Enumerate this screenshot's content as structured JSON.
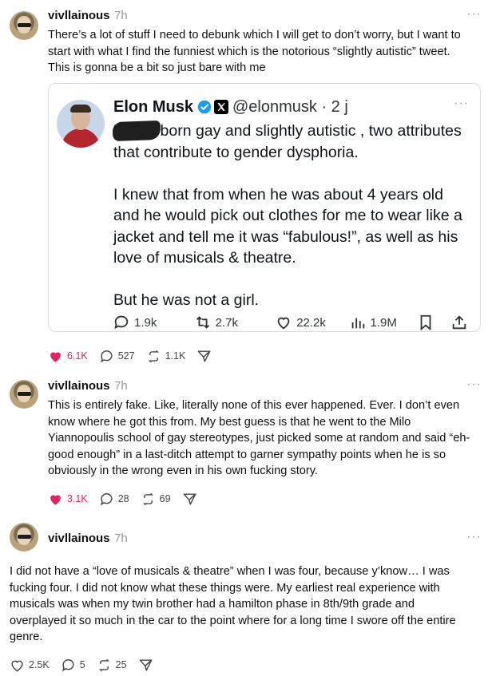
{
  "posts": [
    {
      "username": "vivllainous",
      "time": "7h",
      "more": "···",
      "text_lines": [
        "There’s a lot of stuff I need to debunk which I will get to don’t worry, but I want to",
        "start with what I find the funniest which is the notorious “slightly autistic” tweet.",
        "This is gonna be a bit so just bare with me"
      ],
      "likes": "6.1K",
      "replies": "527",
      "reposts": "1.1K",
      "liked": true
    },
    {
      "username": "vivllainous",
      "time": "7h",
      "more": "···",
      "text_lines": [
        "This is entirely fake. Like, literally none of this ever happened. Ever. I don’t even",
        "know where he got this from. My best guess is that he went to the Milo",
        "Yiannopoulis school of gay stereotypes, just picked some at random and said “eh-",
        "good enough” in a last-ditch attempt to garner sympathy points when he is so",
        "obviously in the wrong even in his own fucking story."
      ],
      "likes": "3.1K",
      "replies": "28",
      "reposts": "69",
      "liked": true
    },
    {
      "username": "vivllainous",
      "time": "7h",
      "more": "···",
      "text_lines": [
        "I did not have a “love of musicals & theatre” when I was four, because y’know… I was",
        "fucking four. I did not know what these things were. My earliest real experience with",
        "musicals was when my twin brother had a hamilton phase in 8th/9th grade and",
        "overplayed it so much in the car to the point where for a long time I swore off the entire",
        "genre."
      ],
      "likes": "2.5K",
      "replies": "5",
      "reposts": "25",
      "liked": false
    }
  ],
  "embed": {
    "name": "Elon Musk",
    "handle": "@elonmusk · 2 j",
    "more": "···",
    "paragraphs": [
      "X  was born gay and slightly autistic , two attributes that contribute to gender dysphoria.",
      "I knew that from when he was about 4 years old and he would pick out clothes for me to wear like a jacket and tell me it was “fabulous!”, as well as his love of musicals & theatre.",
      "But he was not a girl."
    ],
    "replies": "1.9k",
    "reposts": "2.7k",
    "likes": "22.2k",
    "views": "1.9M"
  },
  "colors": {
    "like_red": "#e0245e",
    "verified_blue": "#1d9bf0",
    "muted": "#999999"
  },
  "icons": [
    "heart-icon",
    "comment-icon",
    "repost-icon",
    "share-icon",
    "verified-icon",
    "x-logo-icon",
    "views-icon",
    "bookmark-icon",
    "upload-icon",
    "more-icon"
  ]
}
